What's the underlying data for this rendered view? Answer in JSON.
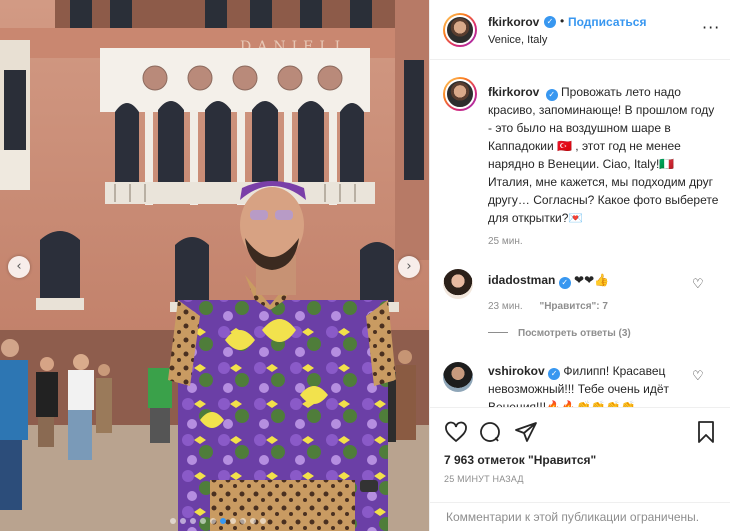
{
  "post": {
    "username": "fkirkorov",
    "verified_icon": "verified-badge-icon",
    "separator": "•",
    "follow_label": "Подписаться",
    "location": "Venice, Italy",
    "more_icon": "more-horizontal-icon",
    "more_label": "···"
  },
  "photo": {
    "building_sign": "DANIELI",
    "prev_icon": "chevron-left-icon",
    "next_icon": "chevron-right-icon",
    "prev_label": "‹",
    "next_label": "›",
    "slide_count": 10,
    "active_slide": 5
  },
  "caption": {
    "username": "fkirkorov",
    "text": "Провожать лето надо красиво, запоминающе! В прошлом году - это было на воздушном шаре в Каппадокии 🇹🇷 , этот год не менее нарядно в Венеции. Ciao, Italy!🇮🇹 Италия, мне кажется, мы подходим друг другу… Согласны? Какое фото выберете для открытки?💌",
    "time": "25 мин."
  },
  "comments": [
    {
      "username": "idadostman",
      "text": "❤❤👍",
      "time": "23 мин.",
      "likes": "\"Нравится\": 7",
      "replies": "Посмотреть ответы (3)"
    },
    {
      "username": "vshirokov",
      "text": "Филипп! Красавец невозможный!!! Тебе очень идёт Венеция!!!🔥🔥👏👏👏👏"
    }
  ],
  "actions": {
    "like_icon": "heart-icon",
    "comment_icon": "comment-icon",
    "share_icon": "share-icon",
    "save_icon": "bookmark-icon",
    "likes_text": "7 963 отметок \"Нравится\"",
    "post_time": "25 МИНУТ НАЗАД",
    "restricted": "Комментарии к этой публикации ограничены."
  },
  "colors": {
    "link_blue": "#3897f0",
    "text": "#262626",
    "secondary": "#8e8e8e",
    "heart_red": "#ed4956"
  }
}
